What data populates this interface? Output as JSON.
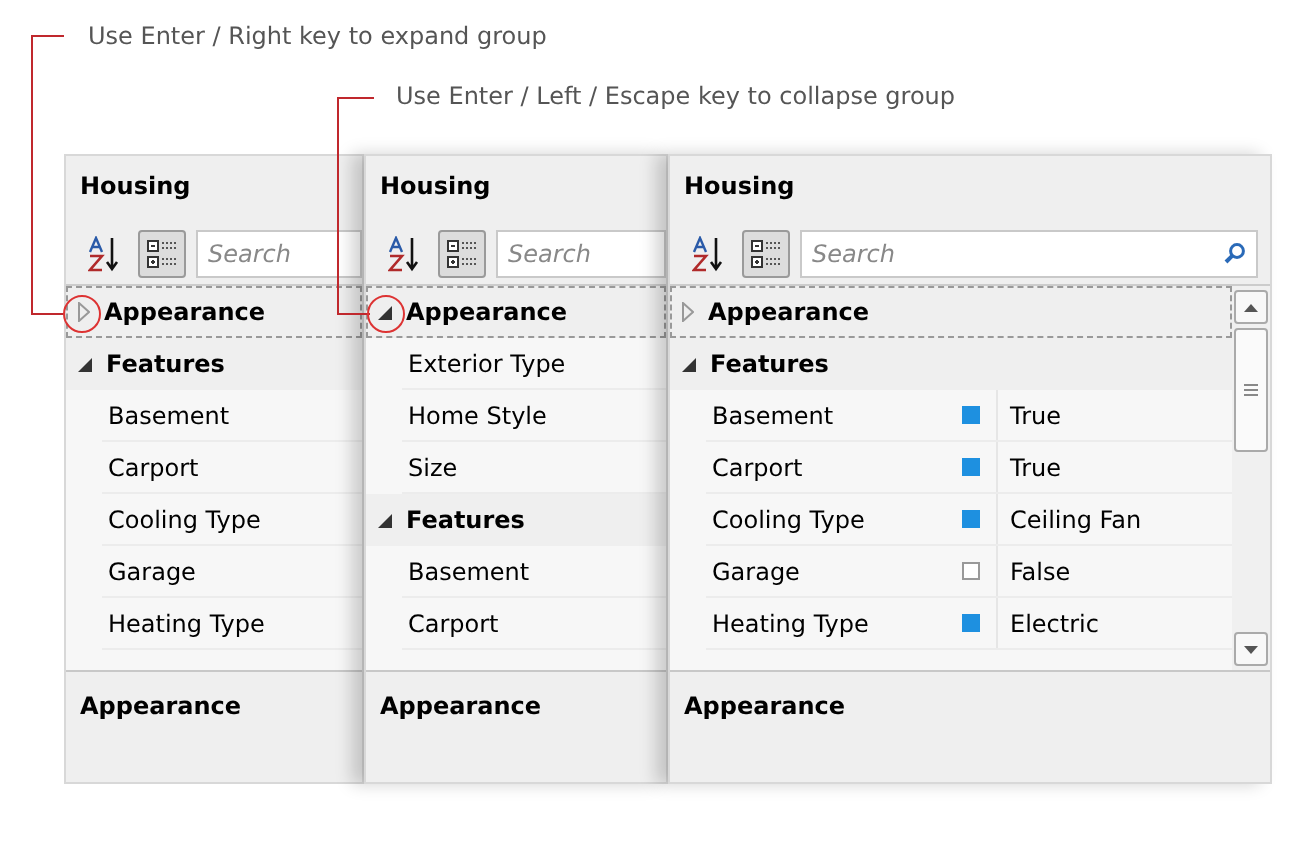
{
  "annotations": [
    {
      "text": "Use Enter / Right key to expand group"
    },
    {
      "text": "Use Enter / Left / Escape key to collapse group"
    }
  ],
  "panels": [
    {
      "title": "Housing",
      "sort_selected": false,
      "categorize_selected": true,
      "search_placeholder": "Search",
      "footer": "Appearance",
      "show_values": false,
      "rows": [
        {
          "kind": "group",
          "label": "Appearance",
          "expanded": false,
          "focused": true
        },
        {
          "kind": "group",
          "label": "Features",
          "expanded": true,
          "focused": false
        },
        {
          "kind": "property",
          "label": "Basement"
        },
        {
          "kind": "property",
          "label": "Carport"
        },
        {
          "kind": "property",
          "label": "Cooling Type"
        },
        {
          "kind": "property",
          "label": "Garage"
        },
        {
          "kind": "property",
          "label": "Heating Type"
        }
      ]
    },
    {
      "title": "Housing",
      "sort_selected": false,
      "categorize_selected": true,
      "search_placeholder": "Search",
      "footer": "Appearance",
      "show_values": false,
      "rows": [
        {
          "kind": "group",
          "label": "Appearance",
          "expanded": true,
          "focused": true
        },
        {
          "kind": "property",
          "label": "Exterior Type"
        },
        {
          "kind": "property",
          "label": "Home Style"
        },
        {
          "kind": "property",
          "label": "Size"
        },
        {
          "kind": "group",
          "label": "Features",
          "expanded": true,
          "focused": false
        },
        {
          "kind": "property",
          "label": "Basement"
        },
        {
          "kind": "property",
          "label": "Carport"
        }
      ]
    },
    {
      "title": "Housing",
      "sort_selected": false,
      "categorize_selected": true,
      "search_placeholder": "Search",
      "footer": "Appearance",
      "show_values": true,
      "rows": [
        {
          "kind": "group",
          "label": "Appearance",
          "expanded": false,
          "focused": true
        },
        {
          "kind": "group",
          "label": "Features",
          "expanded": true,
          "focused": false
        },
        {
          "kind": "property",
          "label": "Basement",
          "checked": true,
          "value": "True"
        },
        {
          "kind": "property",
          "label": "Carport",
          "checked": true,
          "value": "True"
        },
        {
          "kind": "property",
          "label": "Cooling Type",
          "checked": true,
          "value": "Ceiling Fan"
        },
        {
          "kind": "property",
          "label": "Garage",
          "checked": false,
          "value": "False"
        },
        {
          "kind": "property",
          "label": "Heating Type",
          "checked": true,
          "value": "Electric"
        }
      ]
    }
  ]
}
